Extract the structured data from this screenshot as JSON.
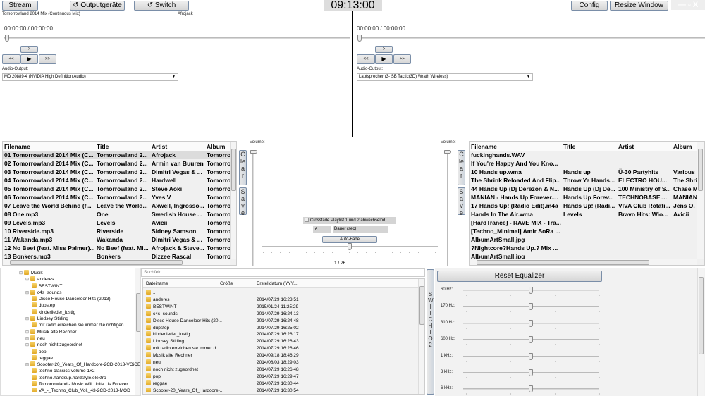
{
  "toolbar": {
    "stream": "Stream",
    "outputs": "↺ Outputgeräte",
    "switch": "↺ Switch",
    "clock": "09:13:00",
    "config": "Config",
    "resize": "Resize Window",
    "window_controls": "— ▫ X"
  },
  "deck1": {
    "track_title": "Tomorrowland 2014 Mix (Continuous Mix)",
    "track_artist": "Afrojack",
    "time": "00:00:00 / 00:00:00",
    "progress": 0,
    "btn_up": ">",
    "btn_prev": "<<",
    "btn_play": "▶",
    "btn_next": ">>",
    "audio_label": "Audio-Output:",
    "audio_device": "MD 20889-4 (NVIDIA High Definition Audio)"
  },
  "deck2": {
    "time": "00:00:00 / 00:00:00",
    "progress": 0,
    "btn_up": ">",
    "btn_prev": "<<",
    "btn_play": "▶",
    "btn_next": ">>",
    "audio_label": "Audio-Output:",
    "audio_device": "Lautsprecher (3- SB Tactic(3D) Wrath Wireless)"
  },
  "playlist_columns": [
    "Filename",
    "Title",
    "Artist",
    "Album"
  ],
  "playlist1": [
    [
      "01 Tomorrowland 2014 Mix (C...",
      "Tomorrowland 2...",
      "Afrojack",
      "Tomorrow"
    ],
    [
      "02 Tomorrowland 2014 Mix (C...",
      "Tomorrowland 2...",
      "Armin van Buuren",
      "Tomorrow"
    ],
    [
      "03 Tomorrowland 2014 Mix (C...",
      "Tomorrowland 2...",
      "Dimitri Vegas & ...",
      "Tomorrow"
    ],
    [
      "04 Tomorrowland 2014 Mix (C...",
      "Tomorrowland 2...",
      "Hardwell",
      "Tomorrow"
    ],
    [
      "05 Tomorrowland 2014 Mix (C...",
      "Tomorrowland 2...",
      "Steve Aoki",
      "Tomorrow"
    ],
    [
      "06 Tomorrowland 2014 Mix (C...",
      "Tomorrowland 2...",
      "Yves V",
      "Tomorrow"
    ],
    [
      "07 Leave the World Behind (f...",
      "Leave the World...",
      "Axwell, Ingrosso...",
      "Tomorrow"
    ],
    [
      "08 One.mp3",
      "One",
      "Swedish House ...",
      "Tomorrow"
    ],
    [
      "09 Levels.mp3",
      "Levels",
      "Avicii",
      "Tomorrow"
    ],
    [
      "10 Riverside.mp3",
      "Riverside",
      "Sidney Samson",
      "Tomorrow"
    ],
    [
      "11 Wakanda.mp3",
      "Wakanda",
      "Dimitri Vegas & ...",
      "Tomorrow"
    ],
    [
      "12 No Beef (feat. Miss Palmer)...",
      "No Beef (feat. Mi...",
      "Afrojack & Steve...",
      "Tomorrow"
    ],
    [
      "13 Bonkers.mp3",
      "Bonkers",
      "Dizzee Rascal",
      "Tomorrow"
    ]
  ],
  "playlist2": [
    [
      "fuckinghands.WAV",
      "",
      "",
      ""
    ],
    [
      "If You're Happy And You Kno...",
      "",
      "",
      ""
    ],
    [
      "10 Hands up.wma",
      "Hands up",
      "Ü-30 Partyhits",
      "Various"
    ],
    [
      "The Shrink Reloaded And Flip...",
      "Throw Ya Hands...",
      "ELECTRO HOU...",
      "The Shrin"
    ],
    [
      "44 Hands Up (Dj Derezon & N...",
      "Hands Up (Dj De...",
      "100 Ministry of S...",
      "Chase M"
    ],
    [
      "MANIAN - Hands Up Forever....",
      "Hands Up Forev...",
      "TECHNOBASE....",
      "MANIAN"
    ],
    [
      "17 Hands Up! (Radio Edit).m4a",
      "Hands Up! (Radi...",
      "VIVA Club Rotati...",
      "Jens O."
    ],
    [
      "Hands In The Air.wma",
      "Levels",
      "Bravo Hits: Wio...",
      "Avicii"
    ],
    [
      "[HardTrance] - RAVE MIX - Tra...",
      "",
      "",
      ""
    ],
    [
      "[Techno_Minimal] Amir SoRa ...",
      "",
      "",
      ""
    ],
    [
      "AlbumArtSmall.jpg",
      "",
      "",
      ""
    ],
    [
      "?Nightcore?Hands Up.? Mix ...",
      "",
      "",
      ""
    ],
    [
      "AlbumArtSmall.jpg",
      "",
      "",
      ""
    ]
  ],
  "side_buttons": {
    "clear": "Clear",
    "save": "Save"
  },
  "mixer": {
    "volume_label": "Volume:",
    "volume_label2": "Volume:",
    "volume1": 1,
    "volume2": 1,
    "crossfade_label": "Crossfade Playlist 1 und 2 abwechselnd",
    "crossfade_checked": false,
    "duration_value": "6",
    "duration_label": "Dauer (sec)",
    "autofade": "Auto-Fade",
    "crossfader": 0.5,
    "counter": "1 / 26"
  },
  "tree": {
    "root": "Musik",
    "items": [
      [
        "anderes",
        true
      ],
      [
        "BESTWINT",
        false
      ],
      [
        "c4s_sounds",
        true
      ],
      [
        "Disco House Danceloor Hits (2013)",
        false
      ],
      [
        "dupstep",
        false
      ],
      [
        "kinderlieder_lustig",
        false
      ],
      [
        "Lindsey Stirling",
        true
      ],
      [
        "mit radio erreichen sie immer die richtigen",
        false
      ],
      [
        "Musik alte Rechner",
        true
      ],
      [
        "neu",
        true
      ],
      [
        "noch nicht zugeordnet",
        true
      ],
      [
        "pop",
        false
      ],
      [
        "reggae",
        false
      ],
      [
        "Scooter-20_Years_Of_Hardcore-2CD-2013-VOiCE",
        true
      ],
      [
        "techno classics volume 1+2",
        false
      ],
      [
        "techno.handsup.hardstyle.elektro",
        false
      ],
      [
        "Tomorrowland - Music Will Unite Us Forever",
        false
      ],
      [
        "VA_-_Techno_Club_Vol._43-2CD-2013-MOD",
        false
      ]
    ]
  },
  "browser": {
    "search_placeholder": "Suchfeld",
    "columns": [
      "Dateiname",
      "Größe",
      "Erstelldatum (YYY..."
    ],
    "files": [
      [
        "..",
        ""
      ],
      [
        "anderes",
        "2014/07/29 16:23:51"
      ],
      [
        "BESTWINT",
        "2015/01/24 11:25:29"
      ],
      [
        "c4s_sounds",
        "2014/07/29 16:24:13"
      ],
      [
        "Disco House Danceloor Hits (20...",
        "2014/07/29 16:24:48"
      ],
      [
        "dupstep",
        "2014/07/29 16:25:02"
      ],
      [
        "kinderlieder_lustig",
        "2014/07/29 16:26:17"
      ],
      [
        "Lindsey Stirling",
        "2014/07/29 16:26:43"
      ],
      [
        "mit radio erreichen sie immer d...",
        "2014/07/29 16:26:46"
      ],
      [
        "Musik alte Rechner",
        "2014/09/18 18:46:29"
      ],
      [
        "neu",
        "2014/08/03 18:29:03"
      ],
      [
        "noch nicht zugeordnet",
        "2014/07/29 16:26:48"
      ],
      [
        "pop",
        "2014/07/29 16:29:47"
      ],
      [
        "reggae",
        "2014/07/29 16:30:44"
      ],
      [
        "Scooter-20_Years_Of_Hardcore-...",
        "2014/07/29 16:30:54"
      ]
    ]
  },
  "switch_to": "SWITCH TO 2",
  "equalizer": {
    "reset": "Reset Equalizer",
    "bands": [
      {
        "label": "60 Hz:",
        "value": 0.5
      },
      {
        "label": "170 Hz:",
        "value": 0.5
      },
      {
        "label": "310 Hz:",
        "value": 0.5
      },
      {
        "label": "600 Hz:",
        "value": 0.5
      },
      {
        "label": "1 kHz:",
        "value": 0.5
      },
      {
        "label": "3 kHz:",
        "value": 0.5
      },
      {
        "label": "6 kHz:",
        "value": 0.5
      }
    ]
  }
}
